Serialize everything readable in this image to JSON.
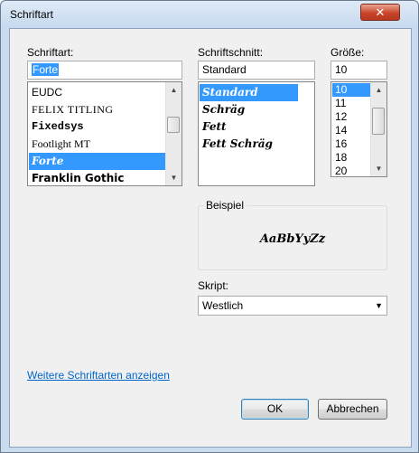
{
  "window": {
    "title": "Schriftart",
    "close_glyph": "✕"
  },
  "font": {
    "label": "Schriftart:",
    "value": "Forte",
    "items": [
      "EUDC",
      "FELIX TITLING",
      "Fixedsys",
      "Footlight MT",
      "Forte",
      "Franklin Gothic"
    ],
    "selected_index": 4
  },
  "style": {
    "label": "Schriftschnitt:",
    "value": "Standard",
    "items": [
      "Standard",
      "Schräg",
      "Fett",
      "Fett Schräg"
    ],
    "selected_index": 0
  },
  "size": {
    "label": "Größe:",
    "value": "10",
    "items": [
      "10",
      "11",
      "12",
      "14",
      "16",
      "18",
      "20"
    ],
    "selected_index": 0
  },
  "sample": {
    "label": "Beispiel",
    "text": "AaBbYyZz"
  },
  "script": {
    "label": "Skript:",
    "value": "Westlich"
  },
  "more_fonts_link": "Weitere Schriftarten anzeigen",
  "buttons": {
    "ok": "OK",
    "cancel": "Abbrechen"
  },
  "colors": {
    "selection": "#3399ff",
    "link": "#0066cc"
  }
}
